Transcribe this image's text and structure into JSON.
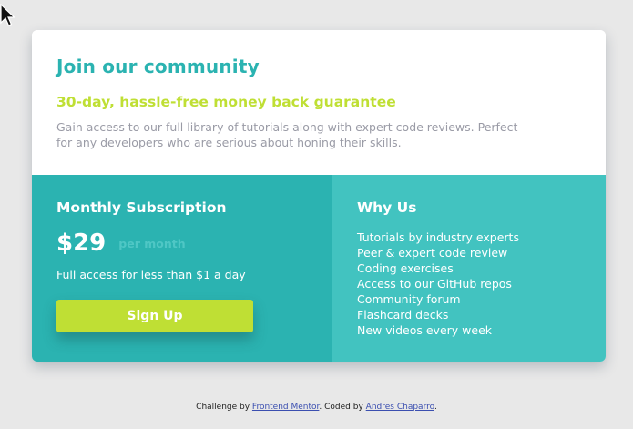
{
  "card": {
    "title": "Join our community",
    "subtitle": "30-day, hassle-free money back guarantee",
    "description": "Gain access to our full library of tutorials along with expert code reviews. Perfect for any developers who are serious about honing their skills."
  },
  "subscription": {
    "heading": "Monthly Subscription",
    "price": "$29",
    "period": "per month",
    "note": "Full access for less than $1 a day",
    "signup_label": "Sign Up"
  },
  "why_us": {
    "heading": "Why Us",
    "items": [
      "Tutorials by industry experts",
      "Peer & expert code review",
      "Coding exercises",
      "Access to our GitHub repos",
      "Community forum",
      "Flashcard decks",
      "New videos every week"
    ]
  },
  "attribution": {
    "prefix": "Challenge by ",
    "challenge_link": "Frontend Mentor",
    "middle": ". Coded by ",
    "author_link": "Andres Chaparro",
    "suffix": "."
  },
  "colors": {
    "cyan": "#2bb3b1",
    "light_cyan": "#42c3c0",
    "lime": "#bfdf34",
    "gray_text": "#9a9ba6",
    "background": "#e8e8e8"
  }
}
